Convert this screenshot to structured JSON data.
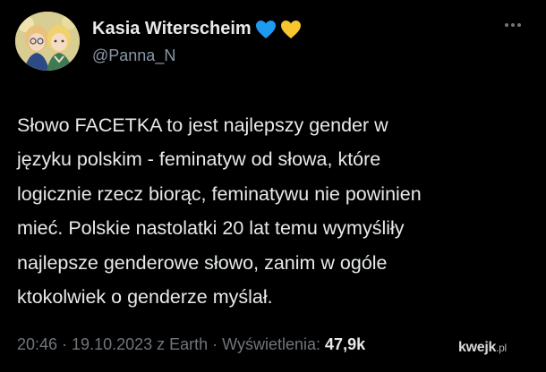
{
  "user": {
    "display_name": "Kasia Witerscheim",
    "handle": "@Panna_N",
    "badges": [
      "blue-heart",
      "yellow-heart"
    ],
    "badge_colors": {
      "blue": "#1d9bf0",
      "yellow": "#f7c52e"
    }
  },
  "tweet": {
    "lines": [
      "Słowo FACETKA to jest najlepszy gender w",
      "języku polskim - feminatyw od słowa, które",
      "logicznie rzecz biorąc, feminatywu nie powinien",
      "mieć. Polskie nastolatki 20 lat temu wymyśliły",
      "najlepsze genderowe słowo, zanim w ogóle",
      "ktokolwiek o genderze myślał."
    ]
  },
  "meta": {
    "time": "20:46",
    "sep1": " · ",
    "date": "19.10.2023",
    "source": " z Earth",
    "sep2": " · ",
    "views_label": "Wyświetlenia: ",
    "views_count": "47,9k"
  },
  "watermark": {
    "brand": "kwejk",
    "tld": ".pl"
  },
  "colors": {
    "background": "#000000",
    "text": "#e7e9ea",
    "secondary": "#71767b"
  },
  "icons": {
    "more": "more-horizontal-icon",
    "avatar": "avatar"
  }
}
